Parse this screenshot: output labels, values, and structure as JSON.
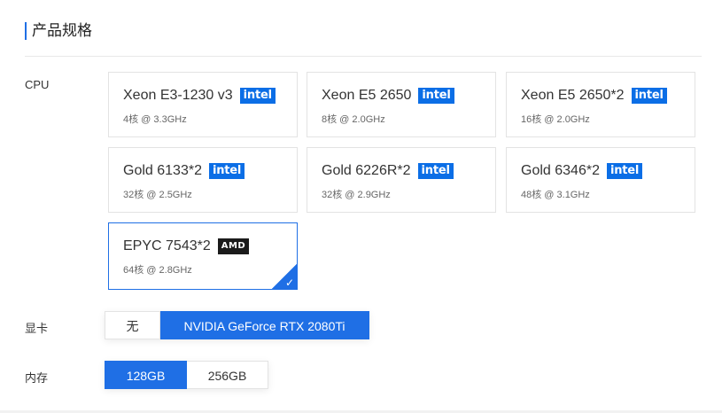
{
  "section": {
    "title": "产品规格"
  },
  "cpu": {
    "label": "CPU",
    "options": [
      {
        "name": "Xeon E3-1230 v3",
        "brand": "intel",
        "spec": "4核 @ 3.3GHz",
        "selected": false
      },
      {
        "name": "Xeon E5 2650",
        "brand": "intel",
        "spec": "8核 @ 2.0GHz",
        "selected": false
      },
      {
        "name": "Xeon E5 2650*2",
        "brand": "intel",
        "spec": "16核 @ 2.0GHz",
        "selected": false
      },
      {
        "name": "Gold 6133*2",
        "brand": "intel",
        "spec": "32核 @ 2.5GHz",
        "selected": false
      },
      {
        "name": "Gold 6226R*2",
        "brand": "intel",
        "spec": "32核 @ 2.9GHz",
        "selected": false
      },
      {
        "name": "Gold 6346*2",
        "brand": "intel",
        "spec": "48核 @ 3.1GHz",
        "selected": false
      },
      {
        "name": "EPYC 7543*2",
        "brand": "amd",
        "spec": "64核 @ 2.8GHz",
        "selected": true
      }
    ],
    "brand_labels": {
      "intel": "intel",
      "amd": "AMD"
    }
  },
  "gpu": {
    "label": "显卡",
    "options": [
      {
        "label": "无",
        "active": false
      },
      {
        "label": "NVIDIA GeForce RTX 2080Ti",
        "active": true
      }
    ]
  },
  "memory": {
    "label": "内存",
    "options": [
      {
        "label": "128GB",
        "active": true
      },
      {
        "label": "256GB",
        "active": false
      }
    ]
  },
  "colors": {
    "accent": "#1f6fe5",
    "intel": "#0b6ee6",
    "amd": "#1b1b1b"
  },
  "icons": {
    "selected": "checkmark-icon"
  }
}
